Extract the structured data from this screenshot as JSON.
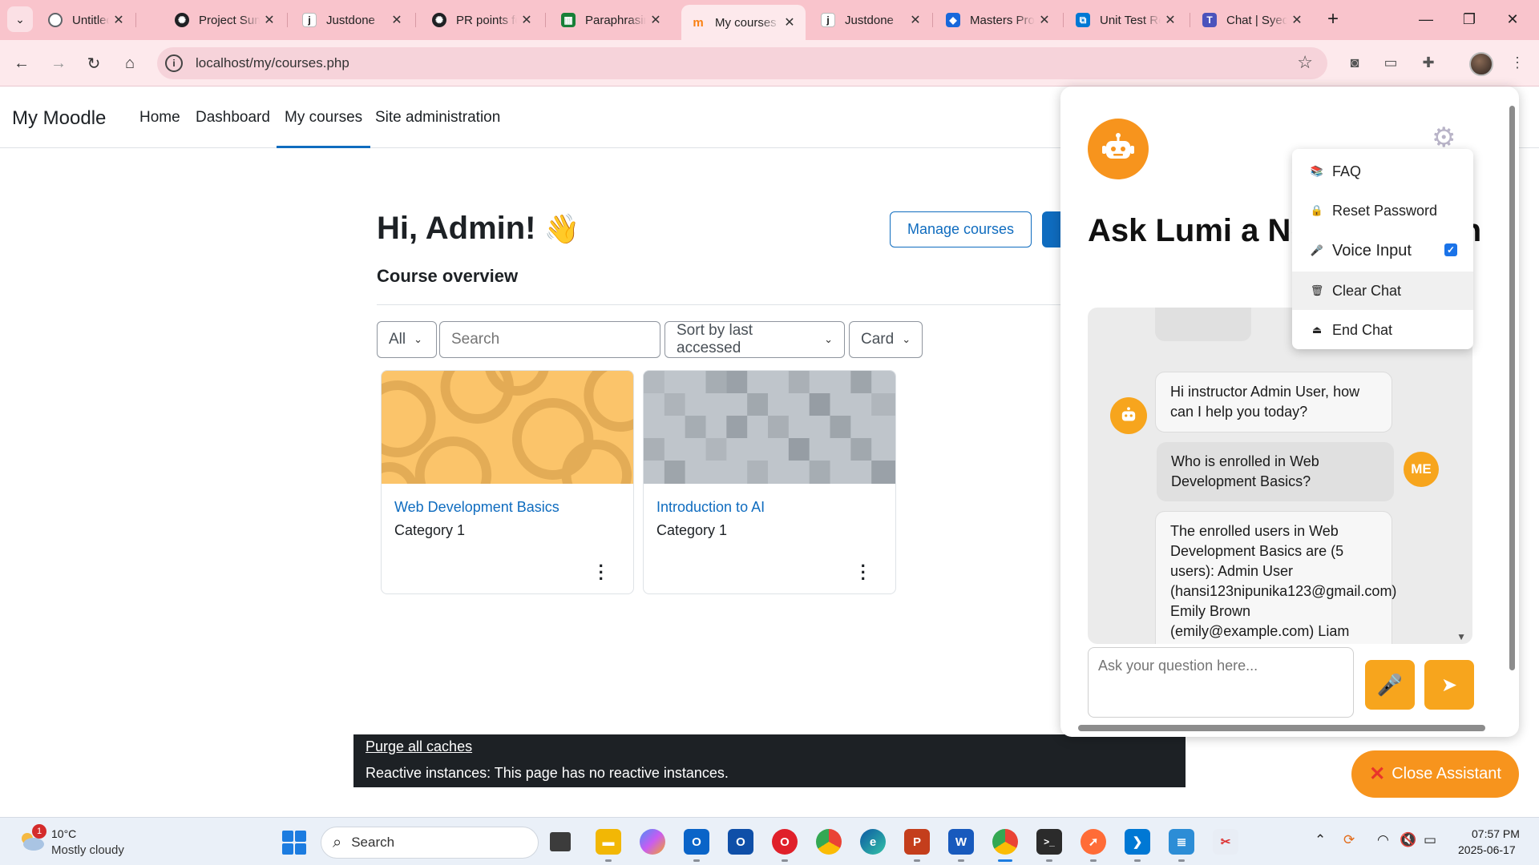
{
  "browser": {
    "tabs": [
      {
        "title": "Untitled",
        "icon": "globe-icon",
        "color": "#5f6368"
      },
      {
        "title": "Project Summary",
        "icon": "chatgpt-icon",
        "color": "#202124"
      },
      {
        "title": "Justdone",
        "icon": "justdone-icon",
        "color": "#ffffff"
      },
      {
        "title": "PR points for",
        "icon": "chatgpt-icon",
        "color": "#202124"
      },
      {
        "title": "Paraphrasing",
        "icon": "sheets-icon",
        "color": "#188038"
      },
      {
        "title": "My courses",
        "icon": "moodle-icon",
        "color": "#f98012"
      },
      {
        "title": "Justdone",
        "icon": "justdone-icon",
        "color": "#ffffff"
      },
      {
        "title": "Masters Project",
        "icon": "jira-icon",
        "color": "#1868db"
      },
      {
        "title": "Unit Test Results",
        "icon": "azure-devops-icon",
        "color": "#0078d4"
      },
      {
        "title": "Chat | Syed",
        "icon": "teams-icon",
        "color": "#4b53bc"
      }
    ],
    "active_tab_index": 5,
    "new_tab_label": "+",
    "url": "localhost/my/courses.php",
    "theme_color": "#f9c4cc"
  },
  "moodle": {
    "brand": "My Moodle",
    "nav": [
      {
        "label": "Home",
        "active": false
      },
      {
        "label": "Dashboard",
        "active": false
      },
      {
        "label": "My courses",
        "active": true
      },
      {
        "label": "Site administration",
        "active": false
      }
    ],
    "greeting": "Hi, Admin!",
    "greeting_emoji": "👋",
    "manage_courses_label": "Manage courses",
    "section_title": "Course overview",
    "filter_label": "All",
    "search_placeholder": "Search",
    "sort_label": "Sort by last accessed",
    "view_label": "Card",
    "courses": [
      {
        "title": "Web Development Basics",
        "category": "Category 1"
      },
      {
        "title": "Introduction to AI",
        "category": "Category 1"
      }
    ],
    "debug": {
      "purge_label": "Purge all caches",
      "reactive_text": "Reactive instances: This page has no reactive instances."
    },
    "accent_color": "#0f6cbf"
  },
  "chatbot": {
    "heading": "Ask Lumi a New Question",
    "menu": [
      {
        "label": "FAQ",
        "icon": "books-icon"
      },
      {
        "label": "Reset Password",
        "icon": "lock-icon"
      },
      {
        "label": "Voice Input",
        "icon": "microphone-icon",
        "checked": true
      },
      {
        "label": "Clear Chat",
        "icon": "trash-icon"
      },
      {
        "label": "End Chat",
        "icon": "exit-icon"
      }
    ],
    "messages": [
      {
        "sender": "bot",
        "text": "Hi instructor Admin User, how can I help you today?"
      },
      {
        "sender": "me",
        "text": "Who is enrolled in Web Development Basics?"
      },
      {
        "sender": "bot",
        "text": "The enrolled users in Web Development Basics are (5 users): Admin User (hansi123nipunika123@gmail.com) Emily Brown (emily@example.com) Liam"
      }
    ],
    "me_avatar_label": "ME",
    "input_placeholder": "Ask your question here...",
    "close_label": "Close Assistant",
    "accent_color": "#f7941d"
  },
  "taskbar": {
    "weather_temp": "10°C",
    "weather_desc": "Mostly cloudy",
    "weather_badge": "1",
    "search_placeholder": "Search",
    "time": "07:57 PM",
    "date": "2025-06-17"
  }
}
